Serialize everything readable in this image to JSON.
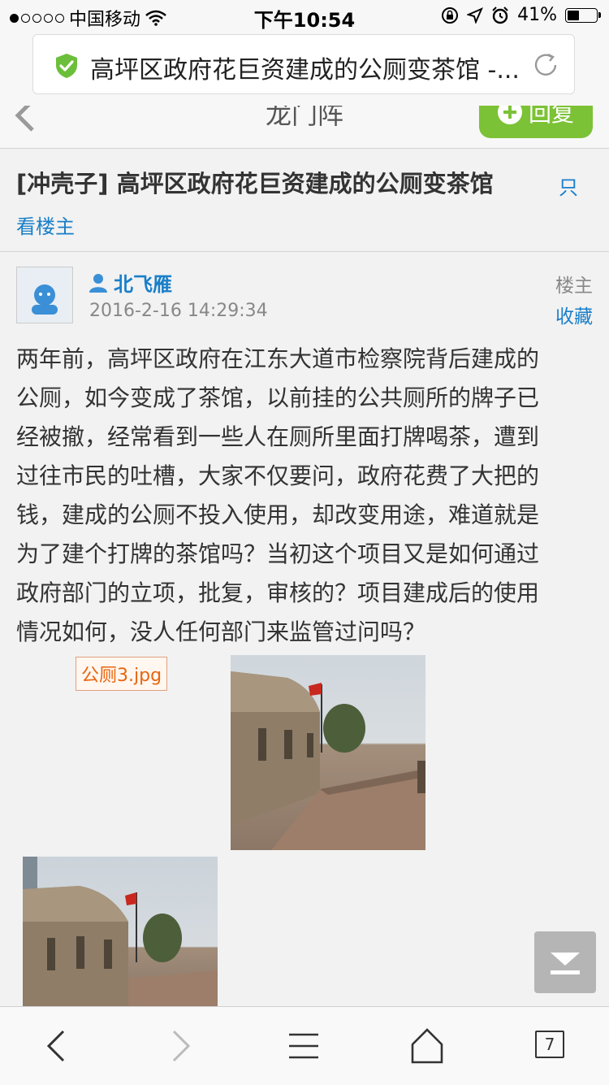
{
  "status_bar": {
    "carrier": "中国移动",
    "time": "下午10:54",
    "battery": "41%",
    "battery_level": 0.41
  },
  "address_bar": {
    "title": "高坪区政府花巨资建成的公厕变茶馆 -..."
  },
  "site_header": {
    "site_name": "龙门阵",
    "reply_label": "回复"
  },
  "thread": {
    "title": "[冲壳子] 高坪区政府花巨资建成的公厕变茶馆",
    "only_op_part1": "只",
    "only_op_part2": "看楼主"
  },
  "post": {
    "author": "北飞雁",
    "time": "2016-2-16 14:29:34",
    "op_label": "楼主",
    "favorite_label": "收藏",
    "lines": [
      "两年前，高坪区政府在江东大道市检察院背后建成的",
      "公厕，如今变成了茶馆，以前挂的公共厕所的牌子已",
      "经被撤，经常看到一些人在厕所里面打牌喝茶，遭到",
      "过往市民的吐槽，大家不仅要问，政府花费了大把的",
      "钱，建成的公厕不投入使用，却改变用途，难道就是",
      "为了建个打牌的茶馆吗？当初这个项目又是如何通过",
      "政府部门的立项，批复，审核的？项目建成后的使用",
      "情况如何，没人任何部门来监管过问吗？"
    ],
    "attachment_name": "公厕3.jpg"
  },
  "toolbar": {
    "tabs_count": "7"
  },
  "colors": {
    "link_blue": "#1a7fc9",
    "reply_green": "#7cc236",
    "shield_green": "#6cbf3a",
    "attachment_orange": "#e8650e"
  }
}
